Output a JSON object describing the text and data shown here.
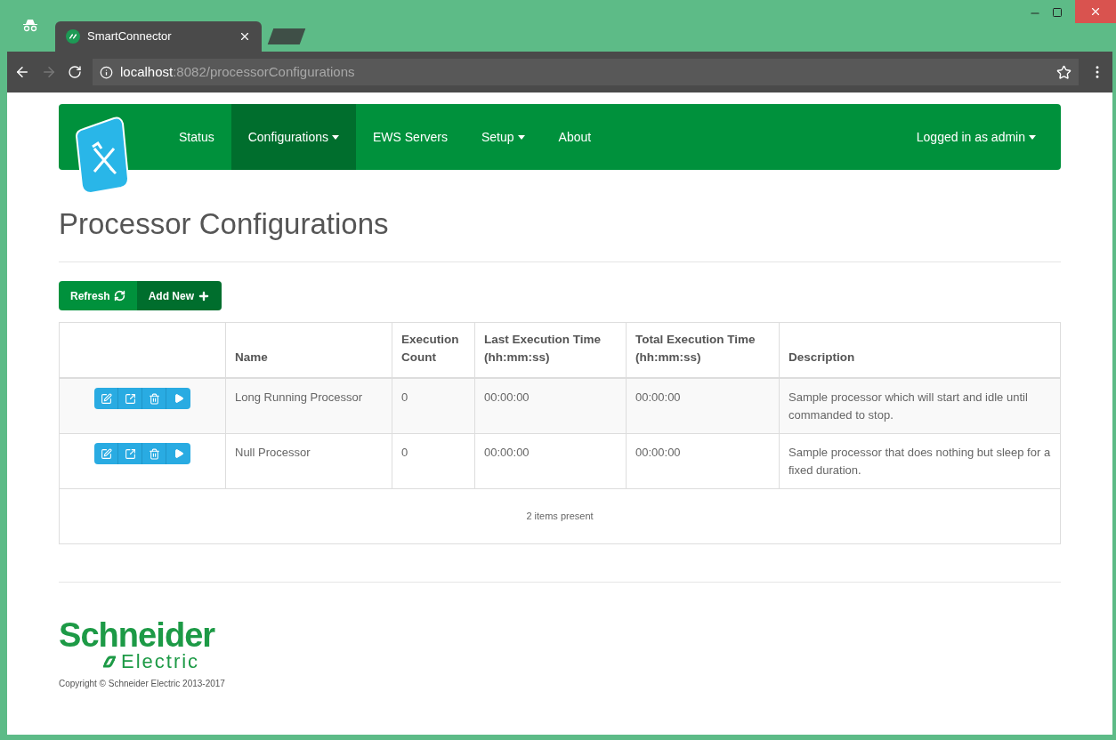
{
  "browser": {
    "tab_title": "SmartConnector",
    "url_host": "localhost",
    "url_path": ":8082/processorConfigurations"
  },
  "navbar": {
    "items": [
      {
        "label": "Status",
        "dropdown": false,
        "selected": false
      },
      {
        "label": "Configurations",
        "dropdown": true,
        "selected": true
      },
      {
        "label": "EWS Servers",
        "dropdown": false,
        "selected": false
      },
      {
        "label": "Setup",
        "dropdown": true,
        "selected": false
      },
      {
        "label": "About",
        "dropdown": false,
        "selected": false
      }
    ],
    "user": "Logged in as admin"
  },
  "page_title": "Processor Configurations",
  "toolbar": [
    {
      "label": "Refresh",
      "kind": "refresh"
    },
    {
      "label": "Add New",
      "kind": "add"
    }
  ],
  "table": {
    "columns": [
      "Name",
      "Execution Count",
      "Last Execution Time (hh:mm:ss)",
      "Total Execution Time (hh:mm:ss)",
      "Description"
    ],
    "rows": [
      {
        "name": "Long Running Processor",
        "execution_count": "0",
        "last_execution_time": "00:00:00",
        "total_execution_time": "00:00:00",
        "description": "Sample processor which will start and idle until commanded to stop."
      },
      {
        "name": "Null Processor",
        "execution_count": "0",
        "last_execution_time": "00:00:00",
        "total_execution_time": "00:00:00",
        "description": "Sample processor that does nothing but sleep for a fixed duration."
      }
    ],
    "footer": "2 items present"
  },
  "footer": {
    "logo_name": "Schneider",
    "logo_sub": "Electric",
    "copyright": "Copyright © Schneider Electric 2013-2017"
  }
}
